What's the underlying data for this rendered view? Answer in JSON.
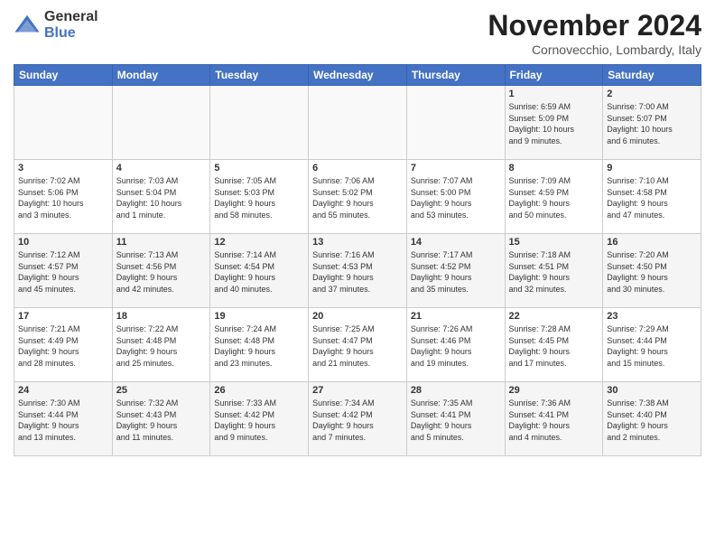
{
  "logo": {
    "general": "General",
    "blue": "Blue"
  },
  "header": {
    "title": "November 2024",
    "location": "Cornovecchio, Lombardy, Italy"
  },
  "weekdays": [
    "Sunday",
    "Monday",
    "Tuesday",
    "Wednesday",
    "Thursday",
    "Friday",
    "Saturday"
  ],
  "rows": [
    [
      {
        "day": "",
        "info": ""
      },
      {
        "day": "",
        "info": ""
      },
      {
        "day": "",
        "info": ""
      },
      {
        "day": "",
        "info": ""
      },
      {
        "day": "",
        "info": ""
      },
      {
        "day": "1",
        "info": "Sunrise: 6:59 AM\nSunset: 5:09 PM\nDaylight: 10 hours\nand 9 minutes."
      },
      {
        "day": "2",
        "info": "Sunrise: 7:00 AM\nSunset: 5:07 PM\nDaylight: 10 hours\nand 6 minutes."
      }
    ],
    [
      {
        "day": "3",
        "info": "Sunrise: 7:02 AM\nSunset: 5:06 PM\nDaylight: 10 hours\nand 3 minutes."
      },
      {
        "day": "4",
        "info": "Sunrise: 7:03 AM\nSunset: 5:04 PM\nDaylight: 10 hours\nand 1 minute."
      },
      {
        "day": "5",
        "info": "Sunrise: 7:05 AM\nSunset: 5:03 PM\nDaylight: 9 hours\nand 58 minutes."
      },
      {
        "day": "6",
        "info": "Sunrise: 7:06 AM\nSunset: 5:02 PM\nDaylight: 9 hours\nand 55 minutes."
      },
      {
        "day": "7",
        "info": "Sunrise: 7:07 AM\nSunset: 5:00 PM\nDaylight: 9 hours\nand 53 minutes."
      },
      {
        "day": "8",
        "info": "Sunrise: 7:09 AM\nSunset: 4:59 PM\nDaylight: 9 hours\nand 50 minutes."
      },
      {
        "day": "9",
        "info": "Sunrise: 7:10 AM\nSunset: 4:58 PM\nDaylight: 9 hours\nand 47 minutes."
      }
    ],
    [
      {
        "day": "10",
        "info": "Sunrise: 7:12 AM\nSunset: 4:57 PM\nDaylight: 9 hours\nand 45 minutes."
      },
      {
        "day": "11",
        "info": "Sunrise: 7:13 AM\nSunset: 4:56 PM\nDaylight: 9 hours\nand 42 minutes."
      },
      {
        "day": "12",
        "info": "Sunrise: 7:14 AM\nSunset: 4:54 PM\nDaylight: 9 hours\nand 40 minutes."
      },
      {
        "day": "13",
        "info": "Sunrise: 7:16 AM\nSunset: 4:53 PM\nDaylight: 9 hours\nand 37 minutes."
      },
      {
        "day": "14",
        "info": "Sunrise: 7:17 AM\nSunset: 4:52 PM\nDaylight: 9 hours\nand 35 minutes."
      },
      {
        "day": "15",
        "info": "Sunrise: 7:18 AM\nSunset: 4:51 PM\nDaylight: 9 hours\nand 32 minutes."
      },
      {
        "day": "16",
        "info": "Sunrise: 7:20 AM\nSunset: 4:50 PM\nDaylight: 9 hours\nand 30 minutes."
      }
    ],
    [
      {
        "day": "17",
        "info": "Sunrise: 7:21 AM\nSunset: 4:49 PM\nDaylight: 9 hours\nand 28 minutes."
      },
      {
        "day": "18",
        "info": "Sunrise: 7:22 AM\nSunset: 4:48 PM\nDaylight: 9 hours\nand 25 minutes."
      },
      {
        "day": "19",
        "info": "Sunrise: 7:24 AM\nSunset: 4:48 PM\nDaylight: 9 hours\nand 23 minutes."
      },
      {
        "day": "20",
        "info": "Sunrise: 7:25 AM\nSunset: 4:47 PM\nDaylight: 9 hours\nand 21 minutes."
      },
      {
        "day": "21",
        "info": "Sunrise: 7:26 AM\nSunset: 4:46 PM\nDaylight: 9 hours\nand 19 minutes."
      },
      {
        "day": "22",
        "info": "Sunrise: 7:28 AM\nSunset: 4:45 PM\nDaylight: 9 hours\nand 17 minutes."
      },
      {
        "day": "23",
        "info": "Sunrise: 7:29 AM\nSunset: 4:44 PM\nDaylight: 9 hours\nand 15 minutes."
      }
    ],
    [
      {
        "day": "24",
        "info": "Sunrise: 7:30 AM\nSunset: 4:44 PM\nDaylight: 9 hours\nand 13 minutes."
      },
      {
        "day": "25",
        "info": "Sunrise: 7:32 AM\nSunset: 4:43 PM\nDaylight: 9 hours\nand 11 minutes."
      },
      {
        "day": "26",
        "info": "Sunrise: 7:33 AM\nSunset: 4:42 PM\nDaylight: 9 hours\nand 9 minutes."
      },
      {
        "day": "27",
        "info": "Sunrise: 7:34 AM\nSunset: 4:42 PM\nDaylight: 9 hours\nand 7 minutes."
      },
      {
        "day": "28",
        "info": "Sunrise: 7:35 AM\nSunset: 4:41 PM\nDaylight: 9 hours\nand 5 minutes."
      },
      {
        "day": "29",
        "info": "Sunrise: 7:36 AM\nSunset: 4:41 PM\nDaylight: 9 hours\nand 4 minutes."
      },
      {
        "day": "30",
        "info": "Sunrise: 7:38 AM\nSunset: 4:40 PM\nDaylight: 9 hours\nand 2 minutes."
      }
    ]
  ]
}
